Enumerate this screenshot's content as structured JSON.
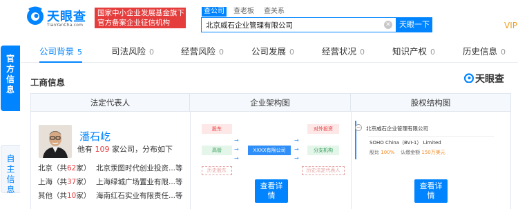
{
  "header": {
    "logo_text": "天眼查",
    "logo_sub": "TianYanCha.com",
    "slogan_line1": "国家中小企业发展基金旗下",
    "slogan_line2": "官方备案企业征信机构",
    "search_tabs": [
      "查公司",
      "查老板",
      "查关系"
    ],
    "search_value": "北京威石企业管理有限公司",
    "search_button": "天眼一下",
    "vip_label": "VIP会"
  },
  "side_tabs": {
    "official": "官方信息",
    "self": "自主信息"
  },
  "nav_tabs": [
    {
      "label": "公司背景",
      "count": "5"
    },
    {
      "label": "司法风险",
      "count": "0"
    },
    {
      "label": "经营风险",
      "count": "0"
    },
    {
      "label": "公司发展",
      "count": "0"
    },
    {
      "label": "经营状况",
      "count": "0"
    },
    {
      "label": "知识产权",
      "count": "0"
    },
    {
      "label": "历史信息",
      "count": "0"
    }
  ],
  "section": {
    "title": "工商信息",
    "watermark": "天眼查"
  },
  "table_headers": [
    "法定代表人",
    "企业架构图",
    "股权结构图"
  ],
  "legal_rep": {
    "name": "潘石屹",
    "desc_prefix": "他有",
    "company_count": "109",
    "desc_suffix": "家公司，分布如下",
    "regions": [
      {
        "city": "北京（共",
        "count": "62",
        "unit": "家）",
        "company": "北京汞图时代创业投资...等"
      },
      {
        "city": "上海（共",
        "count": "37",
        "unit": "家）",
        "company": "上海绿城广场置业有限...等"
      },
      {
        "city": "其他（共",
        "count": "10",
        "unit": "家）",
        "company": "海南红石实业有限责任...等"
      }
    ]
  },
  "org_chart": {
    "shareholder": "股东",
    "executive": "高管",
    "history_shareholder": "历史股东",
    "company": "XXXX有限公司",
    "investment": "对外投资",
    "branch": "分支机构",
    "history_legal": "历史法定代表人",
    "view_button_line1": "查看详",
    "view_button_line2": "情"
  },
  "equity_chart": {
    "root_company": "北京威石企业管理有限公司",
    "child_company": "SOHO China（BVI-1） Limited",
    "ratio_label": "股比",
    "ratio_value": "100%",
    "amount_label": "认缴金额",
    "amount_value": "150万美元",
    "view_button_line1": "查看详",
    "view_button_line2": "情"
  },
  "colors": {
    "brand_blue": "#0084ff",
    "alert_red": "#e53c3c",
    "vip_orange": "#f0a020"
  },
  "icons": [
    "tianyancha-logo-icon",
    "clear-icon",
    "minus-circle-icon",
    "arrow-right-icon"
  ]
}
